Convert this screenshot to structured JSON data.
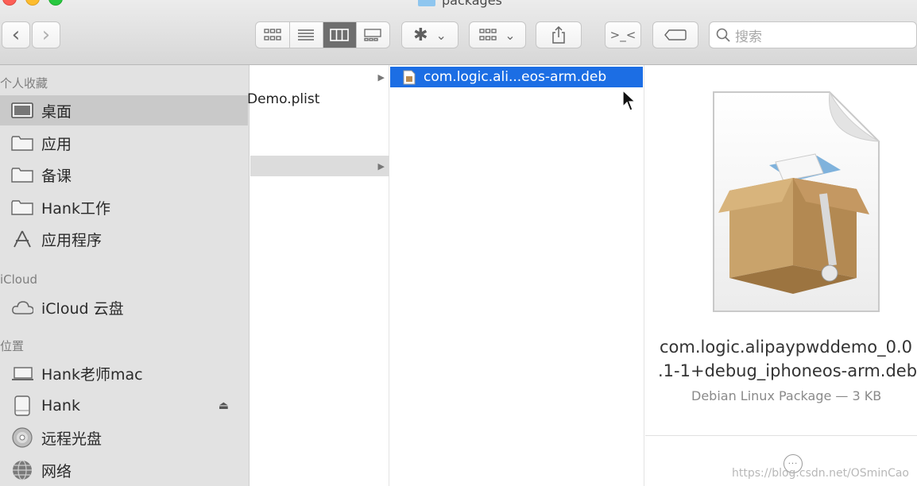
{
  "window": {
    "title": "packages"
  },
  "toolbar": {
    "back": "‹",
    "forward": "›",
    "view_modes": [
      "icon-view",
      "list-view",
      "column-view",
      "gallery-view"
    ],
    "active_view": "column-view",
    "action_caret": "⌄",
    "group_caret": "⌄",
    "terminal_label": ">_<",
    "search_placeholder": "搜索"
  },
  "sidebar": {
    "favorites_header": "个人收藏",
    "favorites": [
      {
        "label": "桌面",
        "icon": "desktop-icon",
        "selected": true
      },
      {
        "label": "应用",
        "icon": "folder-icon"
      },
      {
        "label": "备课",
        "icon": "folder-icon"
      },
      {
        "label": "Hank工作",
        "icon": "folder-icon"
      },
      {
        "label": "应用程序",
        "icon": "applications-icon"
      }
    ],
    "icloud_header": "iCloud",
    "icloud": [
      {
        "label": "iCloud 云盘",
        "icon": "cloud-icon"
      }
    ],
    "locations_header": "位置",
    "locations": [
      {
        "label": "Hank老师mac",
        "icon": "laptop-icon"
      },
      {
        "label": "Hank",
        "icon": "disk-icon",
        "eject": "⏏"
      },
      {
        "label": "远程光盘",
        "icon": "optical-disc-icon"
      },
      {
        "label": "网络",
        "icon": "network-icon"
      }
    ]
  },
  "columns": {
    "col1": {
      "items": [
        {
          "label": "",
          "has_arrow": true
        },
        {
          "label": "Demo.plist",
          "has_arrow": false
        },
        {
          "label": "",
          "has_arrow": true,
          "selected": true
        }
      ]
    },
    "col2": {
      "items": [
        {
          "label": "com.logic.ali...eos-arm.deb",
          "selected": true
        }
      ]
    }
  },
  "preview": {
    "name_line1": "com.logic.alipaypwddemo_0.0",
    "name_line2": ".1-1+debug_iphoneos-arm.deb",
    "meta": "Debian Linux Package — 3 KB",
    "more_label": "···"
  },
  "watermark": "https://blog.csdn.net/OSminCao",
  "colors": {
    "selection_blue": "#1c6ee4",
    "sidebar_bg": "#e2e2e2",
    "toolbar_bg": "#dcdcdc"
  }
}
